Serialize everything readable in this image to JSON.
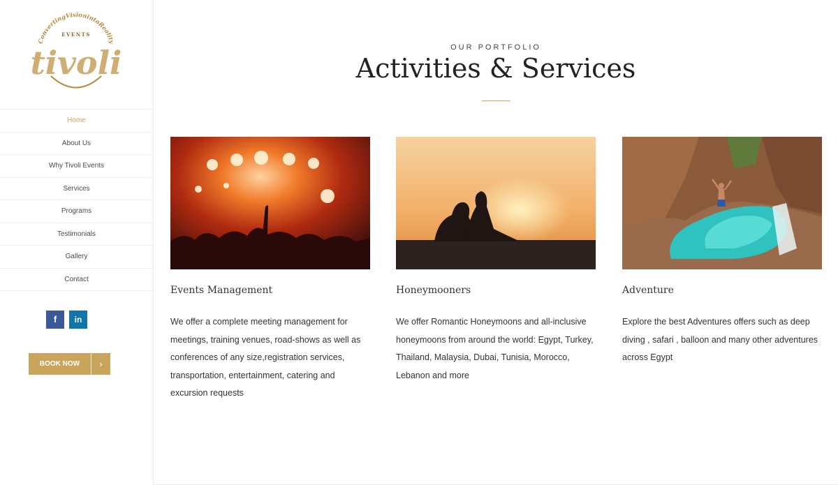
{
  "logo": {
    "arc_text": "ConvertingVisionintoReality",
    "events": "EVENTS",
    "brand": "tivoli"
  },
  "nav": [
    {
      "label": "Home",
      "active": true
    },
    {
      "label": "About Us"
    },
    {
      "label": "Why Tivoli Events"
    },
    {
      "label": "Services"
    },
    {
      "label": "Programs"
    },
    {
      "label": "Testimonials"
    },
    {
      "label": "Gallery"
    },
    {
      "label": "Contact"
    }
  ],
  "social": {
    "facebook": "f",
    "linkedin": "in"
  },
  "book_now": {
    "label": "BOOK NOW",
    "arrow": "›"
  },
  "section": {
    "eyebrow": "OUR PORTFOLIO",
    "title": "Activities & Services"
  },
  "cards": [
    {
      "title": "Events Management",
      "text": "We offer a complete meeting management for meetings, training venues, road-shows as well as conferences of any size,registration services, transportation, entertainment, catering and excursion requests"
    },
    {
      "title": "Honeymooners",
      "text": "We offer Romantic Honeymoons and all-inclusive honeymoons from around the world: Egypt, Turkey, Thailand, Malaysia, Dubai, Tunisia, Morocco, Lebanon and more"
    },
    {
      "title": "Adventure",
      "text": "Explore the best Adventures offers such as deep diving , safari , balloon and many other adventures across Egypt"
    }
  ],
  "colors": {
    "accent": "#c9a45b",
    "facebook": "#3b5998",
    "linkedin": "#0e76a8"
  }
}
